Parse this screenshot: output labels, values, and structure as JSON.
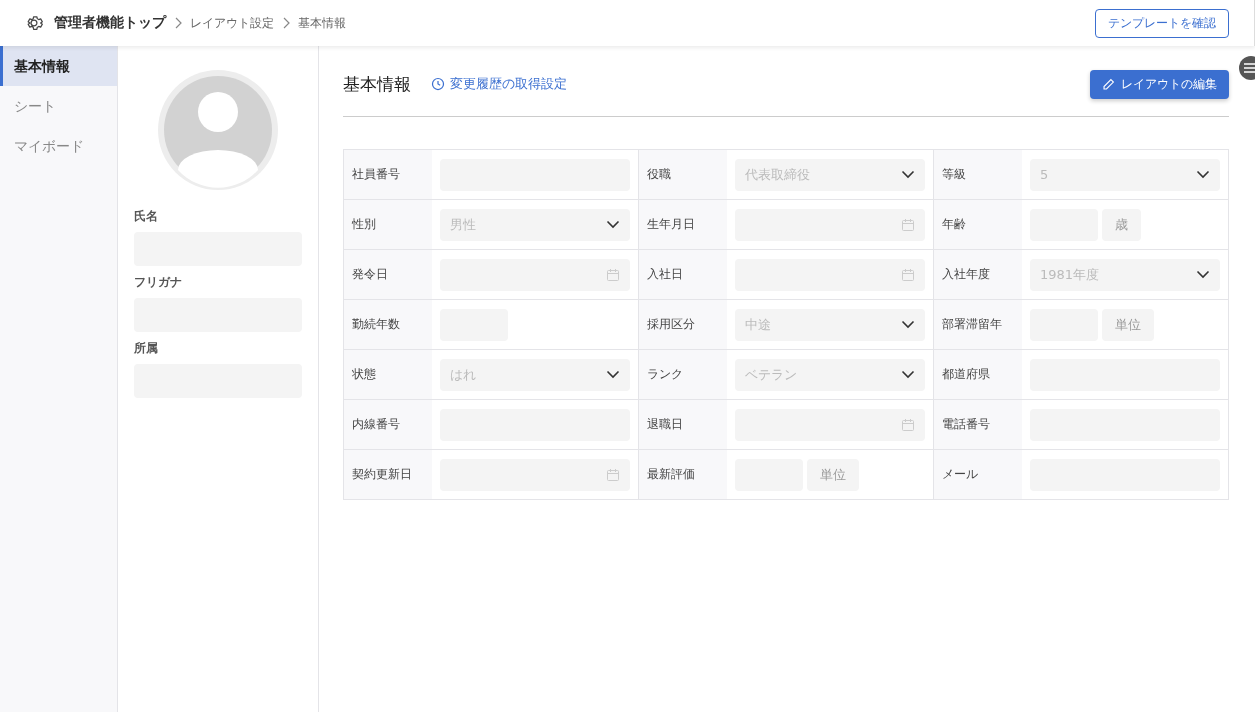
{
  "breadcrumb": [
    {
      "label": "管理者機能トップ",
      "kind": "root"
    },
    {
      "label": "レイアウト設定",
      "kind": "link"
    },
    {
      "label": "基本情報",
      "kind": "current"
    }
  ],
  "header_button": "テンプレートを確認",
  "sidebar": {
    "items": [
      {
        "label": "基本情報",
        "selected": true
      },
      {
        "label": "シート",
        "selected": false
      },
      {
        "label": "マイボード",
        "selected": false
      }
    ]
  },
  "profile": {
    "fields": [
      {
        "label": "氏名"
      },
      {
        "label": "フリガナ"
      },
      {
        "label": "所属"
      }
    ]
  },
  "section": {
    "title": "基本情報",
    "history_link": "変更履歴の取得設定",
    "edit_button": "レイアウトの編集"
  },
  "form": {
    "rows": [
      [
        {
          "label": "社員番号",
          "kind": "text"
        },
        {
          "label": "役職",
          "kind": "select",
          "placeholder": "代表取締役"
        },
        {
          "label": "等級",
          "kind": "select",
          "placeholder": "5"
        }
      ],
      [
        {
          "label": "性別",
          "kind": "select",
          "placeholder": "男性"
        },
        {
          "label": "生年月日",
          "kind": "date"
        },
        {
          "label": "年齢",
          "kind": "short",
          "unit": "歳"
        }
      ],
      [
        {
          "label": "発令日",
          "kind": "date"
        },
        {
          "label": "入社日",
          "kind": "date"
        },
        {
          "label": "入社年度",
          "kind": "select",
          "placeholder": "1981年度"
        }
      ],
      [
        {
          "label": "勤続年数",
          "kind": "short"
        },
        {
          "label": "採用区分",
          "kind": "select",
          "placeholder": "中途"
        },
        {
          "label": "部署滞留年",
          "kind": "short",
          "unit": "単位"
        }
      ],
      [
        {
          "label": "状態",
          "kind": "select",
          "placeholder": "はれ"
        },
        {
          "label": "ランク",
          "kind": "select",
          "placeholder": "ベテラン"
        },
        {
          "label": "都道府県",
          "kind": "text"
        }
      ],
      [
        {
          "label": "内線番号",
          "kind": "text"
        },
        {
          "label": "退職日",
          "kind": "date"
        },
        {
          "label": "電話番号",
          "kind": "text"
        }
      ],
      [
        {
          "label": "契約更新日",
          "kind": "date"
        },
        {
          "label": "最新評価",
          "kind": "short",
          "unit": "単位"
        },
        {
          "label": "メール",
          "kind": "text"
        }
      ]
    ]
  }
}
